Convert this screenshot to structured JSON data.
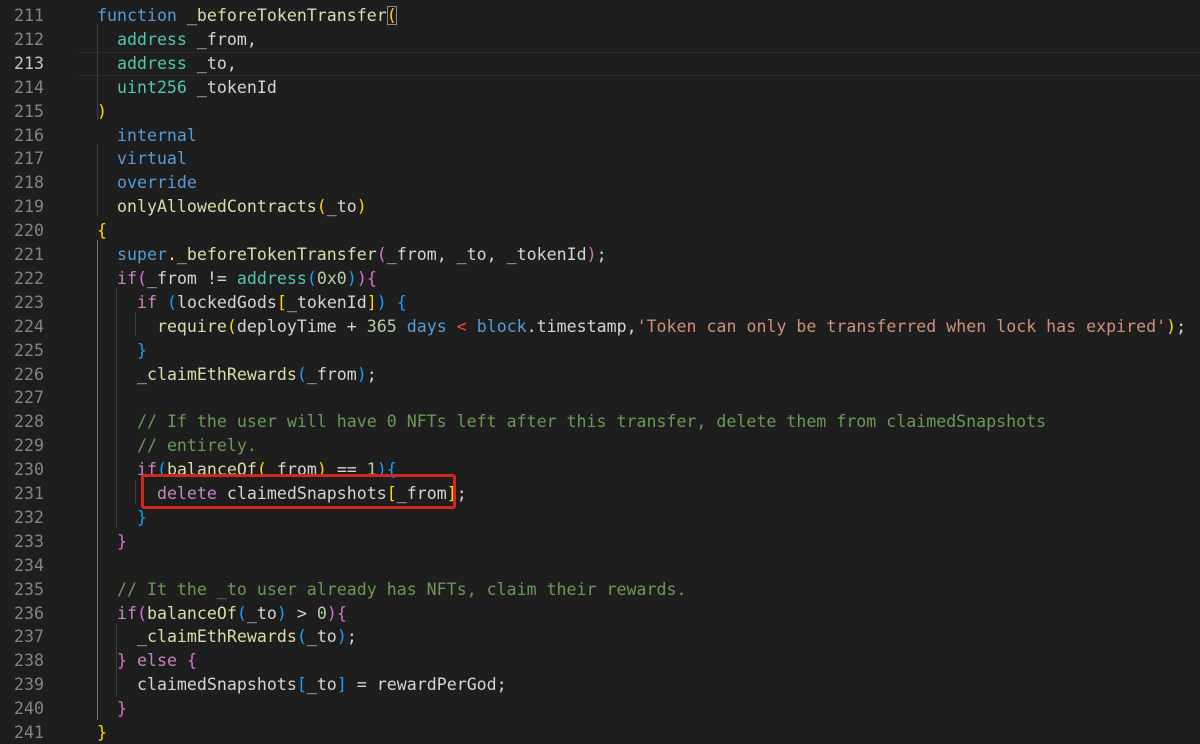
{
  "editor": {
    "active_line": "213",
    "lines": [
      {
        "n": "211",
        "segments": [
          [
            "kw",
            "function"
          ],
          [
            "op",
            " "
          ],
          [
            "fn",
            "_beforeTokenTransfer"
          ],
          [
            "p1",
            "("
          ]
        ]
      },
      {
        "n": "212",
        "segments": [
          [
            "op",
            "  "
          ],
          [
            "ty",
            "address"
          ],
          [
            "op",
            " _from,"
          ]
        ]
      },
      {
        "n": "213",
        "segments": [
          [
            "op",
            "  "
          ],
          [
            "ty",
            "address"
          ],
          [
            "op",
            " _to,"
          ]
        ]
      },
      {
        "n": "214",
        "segments": [
          [
            "op",
            "  "
          ],
          [
            "ty",
            "uint256"
          ],
          [
            "op",
            " _tokenId"
          ]
        ]
      },
      {
        "n": "215",
        "segments": [
          [
            "p1",
            ")"
          ]
        ]
      },
      {
        "n": "216",
        "segments": [
          [
            "op",
            "  "
          ],
          [
            "kw",
            "internal"
          ]
        ]
      },
      {
        "n": "217",
        "segments": [
          [
            "op",
            "  "
          ],
          [
            "kw",
            "virtual"
          ]
        ]
      },
      {
        "n": "218",
        "segments": [
          [
            "op",
            "  "
          ],
          [
            "kw",
            "override"
          ]
        ]
      },
      {
        "n": "219",
        "segments": [
          [
            "op",
            "  "
          ],
          [
            "fn",
            "onlyAllowedContracts"
          ],
          [
            "p1",
            "("
          ],
          [
            "op",
            "_to"
          ],
          [
            "p1",
            ")"
          ]
        ]
      },
      {
        "n": "220",
        "segments": [
          [
            "p1",
            "{"
          ]
        ]
      },
      {
        "n": "221",
        "segments": [
          [
            "op",
            "  "
          ],
          [
            "kw",
            "super"
          ],
          [
            "op",
            "."
          ],
          [
            "fn",
            "_beforeTokenTransfer"
          ],
          [
            "p2",
            "("
          ],
          [
            "op",
            "_from, _to, _tokenId"
          ],
          [
            "p2",
            ")"
          ],
          [
            "op",
            ";"
          ]
        ]
      },
      {
        "n": "222",
        "segments": [
          [
            "op",
            "  "
          ],
          [
            "ctl",
            "if"
          ],
          [
            "p2",
            "("
          ],
          [
            "op",
            "_from != "
          ],
          [
            "ty",
            "address"
          ],
          [
            "p3",
            "("
          ],
          [
            "num",
            "0x0"
          ],
          [
            "p3",
            ")"
          ],
          [
            "p2",
            ")"
          ],
          [
            "p2",
            "{"
          ]
        ]
      },
      {
        "n": "223",
        "segments": [
          [
            "op",
            "    "
          ],
          [
            "ctl",
            "if"
          ],
          [
            "op",
            " "
          ],
          [
            "p3",
            "("
          ],
          [
            "op",
            "lockedGods"
          ],
          [
            "p1",
            "["
          ],
          [
            "op",
            "_tokenId"
          ],
          [
            "p1",
            "]"
          ],
          [
            "p3",
            ")"
          ],
          [
            "op",
            " "
          ],
          [
            "p3",
            "{"
          ]
        ]
      },
      {
        "n": "224",
        "segments": [
          [
            "op",
            "      "
          ],
          [
            "fn",
            "require"
          ],
          [
            "p1",
            "("
          ],
          [
            "op",
            "deployTime + "
          ],
          [
            "num",
            "365"
          ],
          [
            "op",
            " "
          ],
          [
            "kw",
            "days"
          ],
          [
            "op",
            " "
          ],
          [
            "red-op",
            "<"
          ],
          [
            "op",
            " "
          ],
          [
            "kw",
            "block"
          ],
          [
            "op",
            ".timestamp,"
          ],
          [
            "str",
            "'Token can only be transferred when lock has expired'"
          ],
          [
            "p1",
            ")"
          ],
          [
            "op",
            ";"
          ]
        ]
      },
      {
        "n": "225",
        "segments": [
          [
            "op",
            "    "
          ],
          [
            "p3",
            "}"
          ]
        ]
      },
      {
        "n": "226",
        "segments": [
          [
            "op",
            "    "
          ],
          [
            "fn",
            "_claimEthRewards"
          ],
          [
            "p3",
            "("
          ],
          [
            "op",
            "_from"
          ],
          [
            "p3",
            ")"
          ],
          [
            "op",
            ";"
          ]
        ]
      },
      {
        "n": "227",
        "segments": []
      },
      {
        "n": "228",
        "segments": [
          [
            "op",
            "    "
          ],
          [
            "cm",
            "// If the user will have 0 NFTs left after this transfer, delete them from claimedSnapshots"
          ]
        ]
      },
      {
        "n": "229",
        "segments": [
          [
            "op",
            "    "
          ],
          [
            "cm",
            "// entirely."
          ]
        ]
      },
      {
        "n": "230",
        "segments": [
          [
            "op",
            "    "
          ],
          [
            "ctl",
            "if"
          ],
          [
            "p3",
            "("
          ],
          [
            "fn",
            "balanceOf"
          ],
          [
            "p1",
            "("
          ],
          [
            "op",
            " from"
          ],
          [
            "p1",
            ")"
          ],
          [
            "op",
            " == "
          ],
          [
            "num",
            "1"
          ],
          [
            "p3",
            ")"
          ],
          [
            "p3",
            "{"
          ]
        ]
      },
      {
        "n": "231",
        "segments": [
          [
            "op",
            "      "
          ],
          [
            "ctl",
            "delete"
          ],
          [
            "op",
            " claimedSnapshots"
          ],
          [
            "p1",
            "["
          ],
          [
            "op",
            "_from"
          ],
          [
            "p1",
            "]"
          ],
          [
            "op",
            ";"
          ]
        ]
      },
      {
        "n": "232",
        "segments": [
          [
            "op",
            "    "
          ],
          [
            "p3",
            "}"
          ]
        ]
      },
      {
        "n": "233",
        "segments": [
          [
            "op",
            "  "
          ],
          [
            "p2",
            "}"
          ]
        ]
      },
      {
        "n": "234",
        "segments": []
      },
      {
        "n": "235",
        "segments": [
          [
            "op",
            "  "
          ],
          [
            "cm",
            "// It the _to user already has NFTs, claim their rewards."
          ]
        ]
      },
      {
        "n": "236",
        "segments": [
          [
            "op",
            "  "
          ],
          [
            "ctl",
            "if"
          ],
          [
            "p2",
            "("
          ],
          [
            "fn",
            "balanceOf"
          ],
          [
            "p3",
            "("
          ],
          [
            "op",
            "_to"
          ],
          [
            "p3",
            ")"
          ],
          [
            "op",
            " > "
          ],
          [
            "num",
            "0"
          ],
          [
            "p2",
            ")"
          ],
          [
            "p2",
            "{"
          ]
        ]
      },
      {
        "n": "237",
        "segments": [
          [
            "op",
            "    "
          ],
          [
            "fn",
            "_claimEthRewards"
          ],
          [
            "p3",
            "("
          ],
          [
            "op",
            "_to"
          ],
          [
            "p3",
            ")"
          ],
          [
            "op",
            ";"
          ]
        ]
      },
      {
        "n": "238",
        "segments": [
          [
            "op",
            "  "
          ],
          [
            "p2",
            "}"
          ],
          [
            "op",
            " "
          ],
          [
            "ctl",
            "else"
          ],
          [
            "op",
            " "
          ],
          [
            "p2",
            "{"
          ]
        ]
      },
      {
        "n": "239",
        "segments": [
          [
            "op",
            "    "
          ],
          [
            "op",
            "claimedSnapshots"
          ],
          [
            "p3",
            "["
          ],
          [
            "op",
            "_to"
          ],
          [
            "p3",
            "]"
          ],
          [
            "op",
            " = rewardPerGod;"
          ]
        ]
      },
      {
        "n": "240",
        "segments": [
          [
            "op",
            "  "
          ],
          [
            "p2",
            "}"
          ]
        ]
      },
      {
        "n": "241",
        "segments": [
          [
            "p1",
            "}"
          ]
        ]
      }
    ]
  },
  "annotation": {
    "label": "highlighted-delete-statement",
    "color": "#d0281f"
  },
  "colors": {
    "background": "#1e1e1e",
    "keyword": "#569cd6",
    "control": "#c586c0",
    "function": "#dcdcaa",
    "type": "#4ec9b0",
    "number": "#b5cea8",
    "string": "#ce9178",
    "comment": "#6a9955"
  }
}
